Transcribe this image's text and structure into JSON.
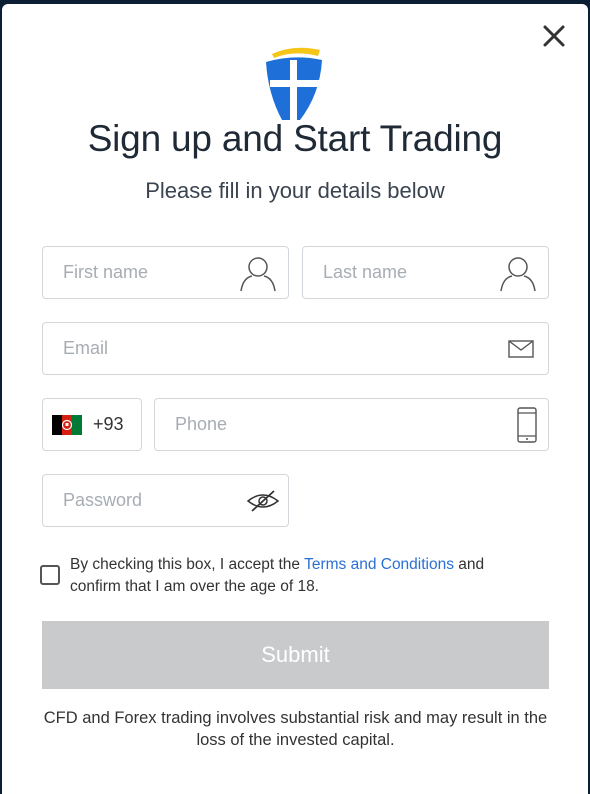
{
  "modal": {
    "title": "Sign up and Start Trading",
    "subtitle": "Please fill in your details below"
  },
  "form": {
    "first_name_placeholder": "First name",
    "last_name_placeholder": "Last name",
    "email_placeholder": "Email",
    "country_code": "+93",
    "phone_placeholder": "Phone",
    "password_placeholder": "Password",
    "consent": {
      "before_link": "By checking this box, I accept the ",
      "link_label": "Terms and Conditions",
      "after_link": " and confirm that I am over the age of 18."
    },
    "submit_label": "Submit"
  },
  "footer": {
    "risk_warning": "CFD and Forex trading involves substantial risk and may result in the loss of the invested capital."
  },
  "colors": {
    "background": "#0c1e33",
    "logo_blue": "#1f6fd9",
    "logo_yellow": "#f5c518",
    "link": "#2a6fd6",
    "submit_disabled": "#c8cacc"
  },
  "icons": {
    "close": "close-icon",
    "first_name": "user-icon",
    "last_name": "user-icon",
    "email": "envelope-icon",
    "phone": "mobile-phone-icon",
    "password": "eye-slash-icon",
    "flag": "afghanistan-flag-icon"
  }
}
